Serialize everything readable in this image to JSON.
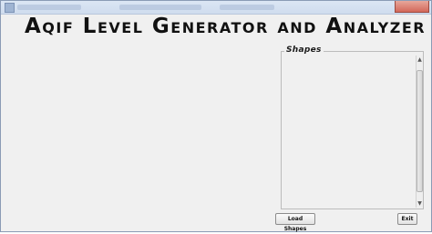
{
  "app": {
    "title": "Aqif Level Generator and Analyzer"
  },
  "shapes_panel": {
    "legend": "Shapes",
    "items": []
  },
  "buttons": {
    "load_shapes": "Load Shapes",
    "exit": "Exit"
  },
  "icons": {
    "window_icon": "app-window-icon",
    "scroll_up": "scroll-up-arrow-icon",
    "scroll_down": "scroll-down-arrow-icon"
  },
  "colors": {
    "window_background": "#f0f0f0",
    "title_text": "#111111",
    "close_button": "#d3685a"
  }
}
